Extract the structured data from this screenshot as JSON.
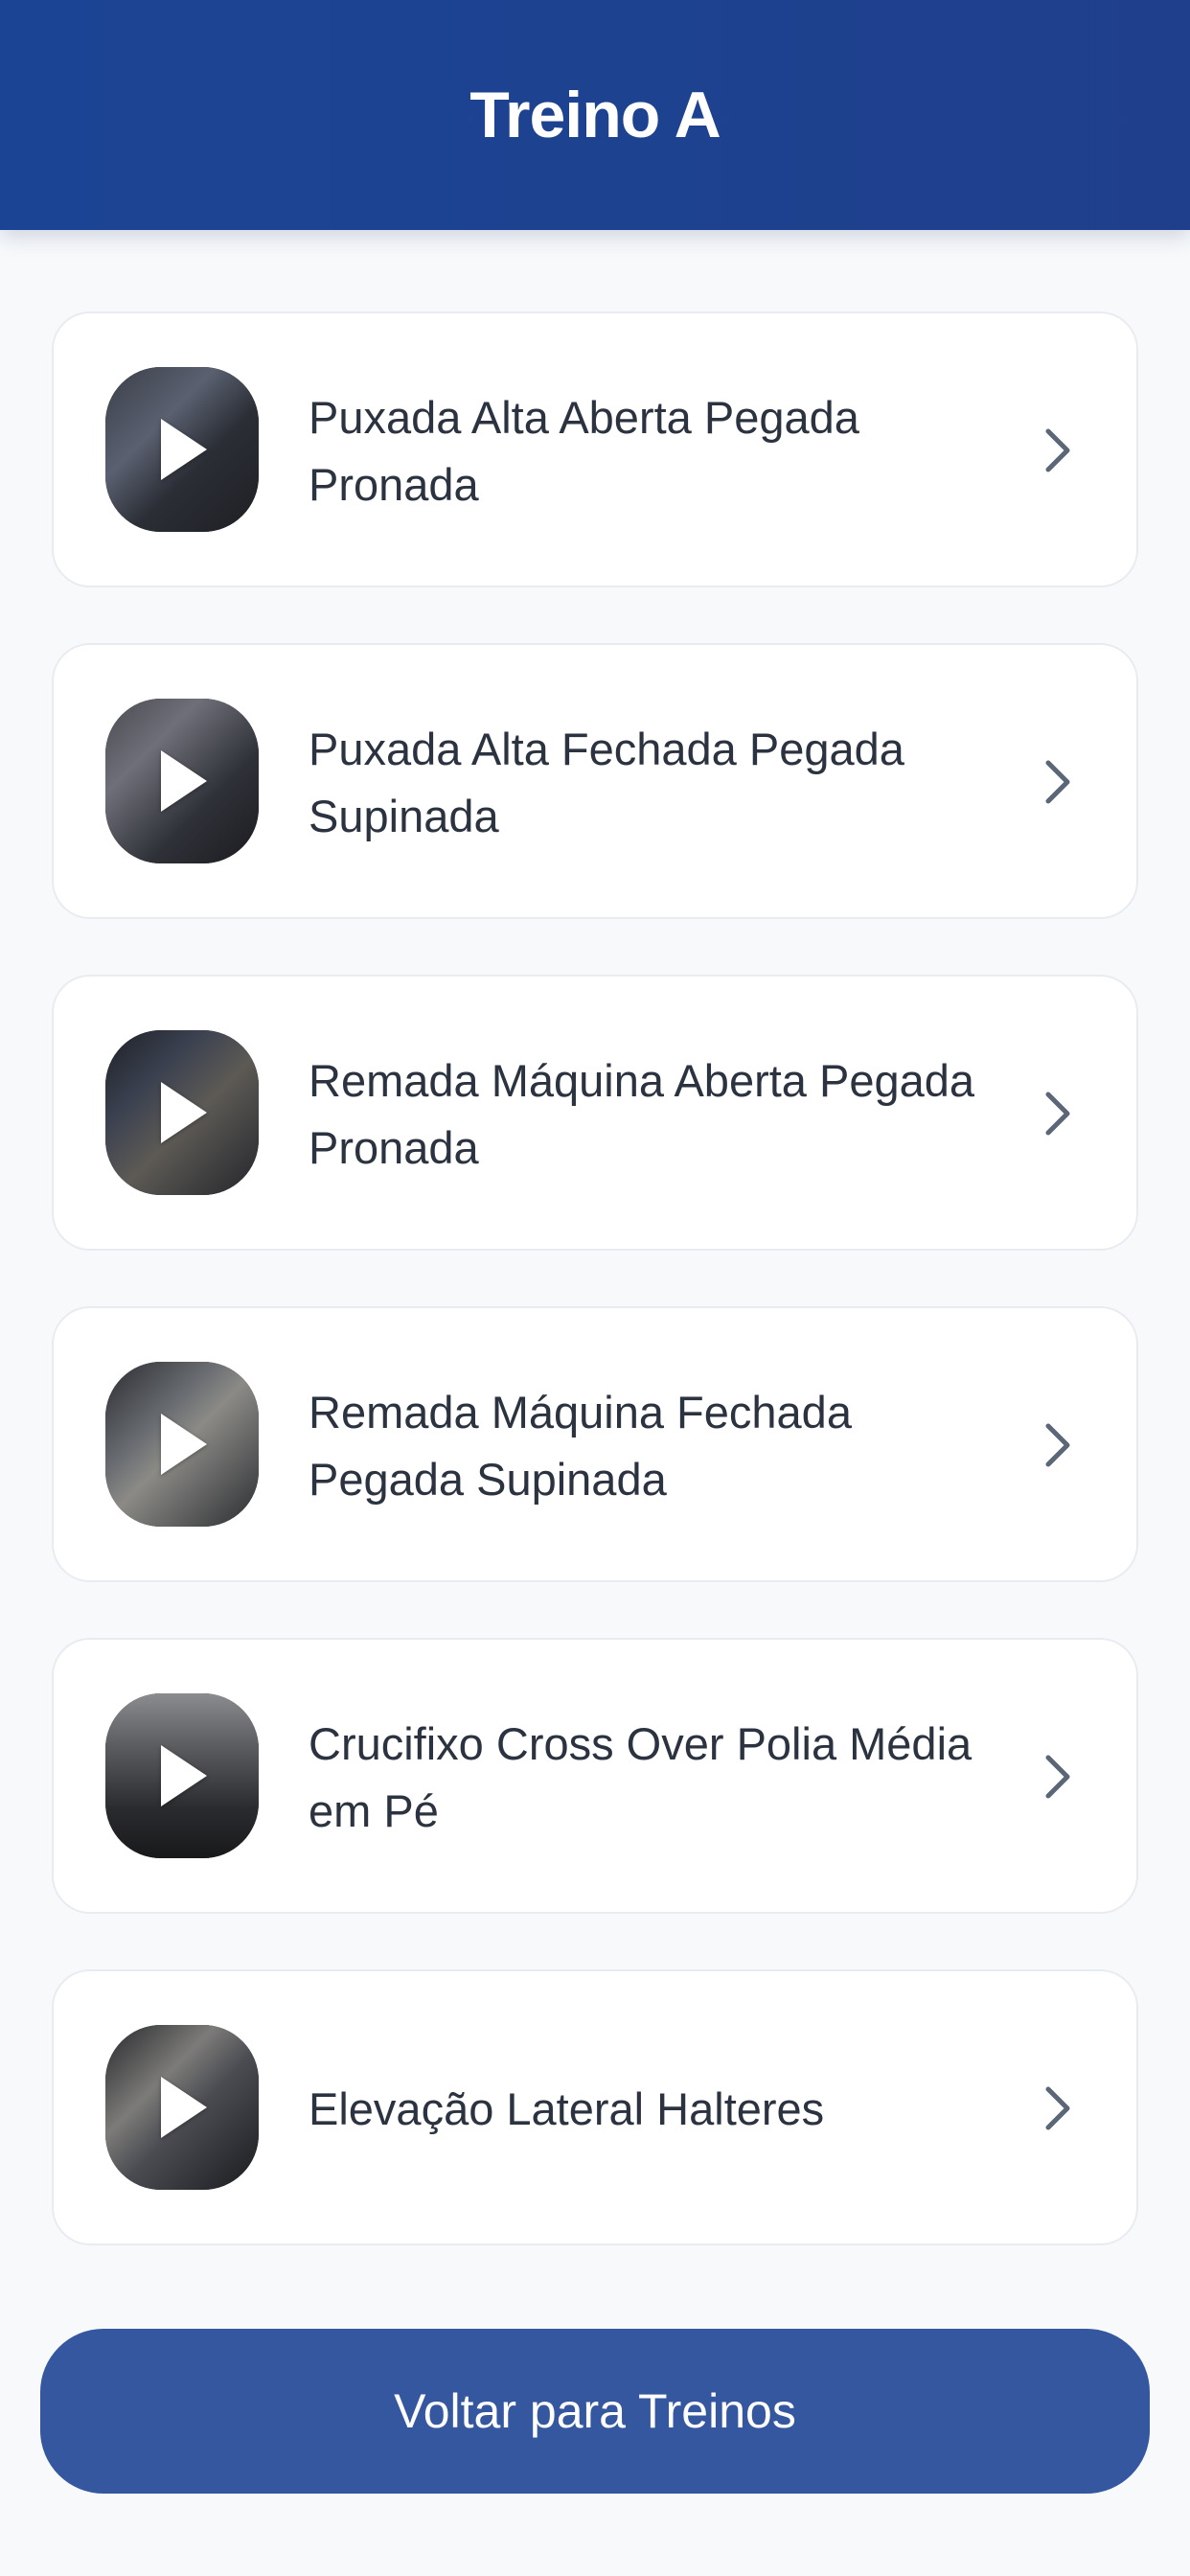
{
  "header": {
    "title": "Treino A"
  },
  "exercises": [
    {
      "title": "Puxada Alta Aberta Pegada Pronada"
    },
    {
      "title": "Puxada Alta Fechada Pegada Supinada"
    },
    {
      "title": "Remada Máquina Aberta Pegada Pronada"
    },
    {
      "title": "Remada Máquina Fechada Pegada Supinada"
    },
    {
      "title": "Crucifixo Cross Over Polia Média em Pé"
    },
    {
      "title": "Elevação Lateral Halteres"
    }
  ],
  "footer": {
    "back_label": "Voltar para Treinos"
  },
  "colors": {
    "header_bg": "#1b4594",
    "button_bg": "#34579f",
    "page_bg": "#f7f9fb",
    "text": "#2c3340",
    "chevron": "#5b6677"
  },
  "icons": {
    "play": "play-icon",
    "chevron": "chevron-right-icon"
  }
}
